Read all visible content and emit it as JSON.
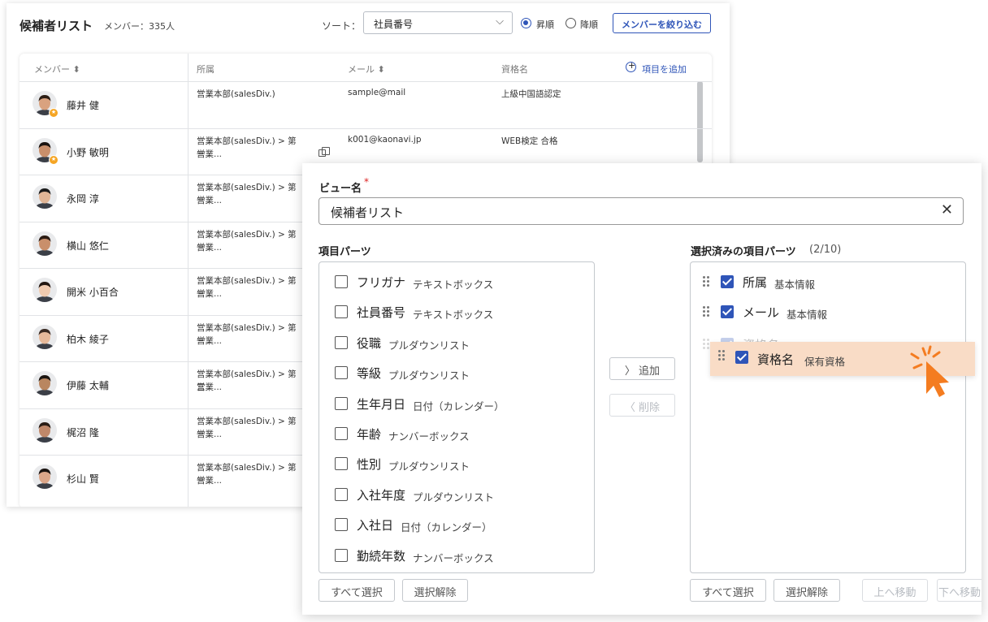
{
  "list": {
    "title": "候補者リスト",
    "member_count": "メンバー：335人",
    "sort_label": "ソート：",
    "sort_value": "社員番号",
    "asc_label": "昇順",
    "desc_label": "降順",
    "filter_button": "メンバーを絞り込む",
    "columns": {
      "member": "メンバー ⬍",
      "dept": "所属",
      "mail": "メール ⬍",
      "qualification": "資格名",
      "add": "項目を追加"
    },
    "rows": [
      {
        "name": "藤井 健",
        "dept1": "営業本部(salesDiv.)",
        "dept2": "",
        "mail": "sample@mail",
        "qual": "上級中国語認定",
        "star": true,
        "skin": "#d9a27f",
        "hair": "#2b1d14"
      },
      {
        "name": "小野 敏明",
        "dept1": "営業本部(salesDiv.) > 第一",
        "dept2": "営業...",
        "mail": "k001@kaonavi.jp",
        "qual": "WEB検定 合格",
        "star": true,
        "skin": "#c98f6b",
        "hair": "#1b1410"
      },
      {
        "name": "永岡 淳",
        "dept1": "営業本部(salesDiv.) > 第一",
        "dept2": "営業...",
        "mail": "",
        "qual": "",
        "star": false,
        "skin": "#e0b596",
        "hair": "#1a1a1a"
      },
      {
        "name": "横山 悠仁",
        "dept1": "営業本部(salesDiv.) > 第一",
        "dept2": "営業...",
        "mail": "",
        "qual": "",
        "star": false,
        "skin": "#c98f6b",
        "hair": "#2a1a12"
      },
      {
        "name": "開米 小百合",
        "dept1": "営業本部(salesDiv.) > 第一",
        "dept2": "営業...",
        "mail": "",
        "qual": "",
        "star": false,
        "skin": "#f0cbb0",
        "hair": "#231711"
      },
      {
        "name": "柏木 綾子",
        "dept1": "営業本部(salesDiv.) > 第一",
        "dept2": "営業...",
        "mail": "",
        "qual": "",
        "star": false,
        "skin": "#e6b99a",
        "hair": "#3a2a22"
      },
      {
        "name": "伊藤 太輔",
        "dept1": "営業本部(salesDiv.) > 第三",
        "dept2": "営業...",
        "mail": "",
        "qual": "",
        "star": false,
        "skin": "#b98660",
        "hair": "#1a1410"
      },
      {
        "name": "梶沼 隆",
        "dept1": "営業本部(salesDiv.) > 第一",
        "dept2": "営業...",
        "mail": "",
        "qual": "",
        "star": false,
        "skin": "#c0886a",
        "hair": "#2a1d16"
      },
      {
        "name": "杉山 賢",
        "dept1": "営業本部(salesDiv.) > 第一",
        "dept2": "営業...",
        "mail": "",
        "qual": "",
        "star": false,
        "skin": "#dba689",
        "hair": "#1a1310"
      }
    ]
  },
  "dialog": {
    "view_name_label": "ビュー名",
    "required_mark": "*",
    "view_name_value": "候補者リスト",
    "parts_label": "項目パーツ",
    "selected_label": "選択済みの項目パーツ",
    "selected_count": "(2/10)",
    "parts": [
      {
        "name": "フリガナ",
        "type": "テキストボックス"
      },
      {
        "name": "社員番号",
        "type": "テキストボックス"
      },
      {
        "name": "役職",
        "type": "プルダウンリスト"
      },
      {
        "name": "等級",
        "type": "プルダウンリスト"
      },
      {
        "name": "生年月日",
        "type": "日付（カレンダー）"
      },
      {
        "name": "年齢",
        "type": "ナンバーボックス"
      },
      {
        "name": "性別",
        "type": "プルダウンリスト"
      },
      {
        "name": "入社年度",
        "type": "プルダウンリスト"
      },
      {
        "name": "入社日",
        "type": "日付（カレンダー）"
      },
      {
        "name": "勤続年数",
        "type": "ナンバーボックス"
      }
    ],
    "selected": [
      {
        "name": "所属",
        "type": "基本情報"
      },
      {
        "name": "メール",
        "type": "基本情報"
      }
    ],
    "dragging": {
      "name": "資格名",
      "type": "保有資格"
    },
    "add_button": "〉 追加",
    "remove_button": "〈 削除",
    "left_select_all": "すべて選択",
    "left_deselect": "選択解除",
    "right_select_all": "すべて選択",
    "right_deselect": "選択解除",
    "move_up": "上へ移動",
    "move_down": "下へ移動"
  },
  "colors": {
    "accent": "#2f55b8",
    "drag_highlight": "#f9dcc6",
    "cursor": "#f47c20"
  }
}
